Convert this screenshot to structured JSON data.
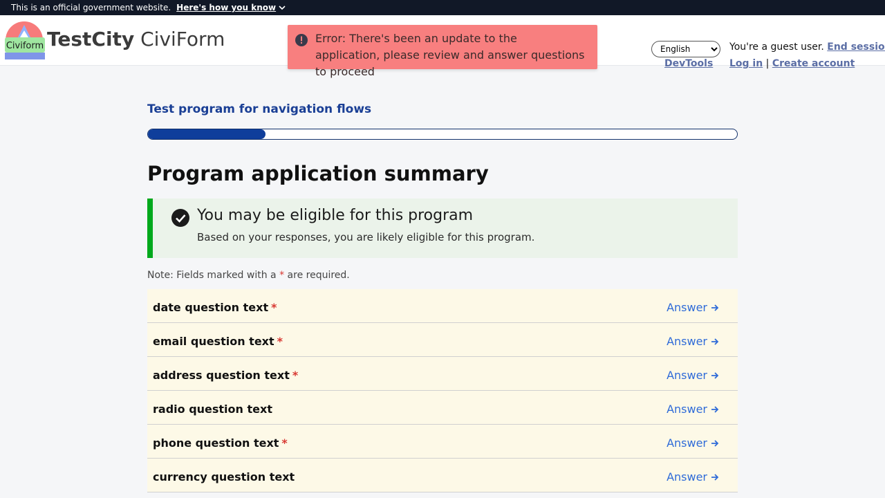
{
  "gov_banner": {
    "text": "This is an official government website.",
    "how_label": "Here's how you know"
  },
  "header": {
    "logo_text": "Civiform",
    "brand_bold": "TestCity",
    "brand_light": "CiviForm",
    "language": "English",
    "devtools": "DevTools",
    "guest_text": "You're a guest user.",
    "end_session": "End session",
    "login": "Log in",
    "separator": "|",
    "create_account": "Create account"
  },
  "toast": {
    "message": "Error: There's been an update to the application, please review and answer questions to proceed"
  },
  "program": {
    "name": "Test program for navigation flows",
    "progress": 0.2
  },
  "page_title": "Program application summary",
  "eligibility": {
    "title": "You may be eligible for this program",
    "description": "Based on your responses, you are likely eligible for this program."
  },
  "note": {
    "prefix": "Note: Fields marked with a",
    "star": "*",
    "suffix": "are required."
  },
  "questions": [
    {
      "text": "date question text",
      "required": "*",
      "action": "Answer"
    },
    {
      "text": "email question text",
      "required": "*",
      "action": "Answer"
    },
    {
      "text": "address question text",
      "required": "*",
      "action": "Answer"
    },
    {
      "text": "radio question text",
      "required": "",
      "action": "Answer"
    },
    {
      "text": "phone question text",
      "required": "*",
      "action": "Answer"
    },
    {
      "text": "currency question text",
      "required": "",
      "action": "Answer"
    }
  ],
  "colors": {
    "banner_bg": "#111827",
    "progress_fill": "#0f3e9b",
    "error_bg": "#f87f7f",
    "eligible_accent": "#00a91c",
    "link": "#2f6bd8"
  }
}
